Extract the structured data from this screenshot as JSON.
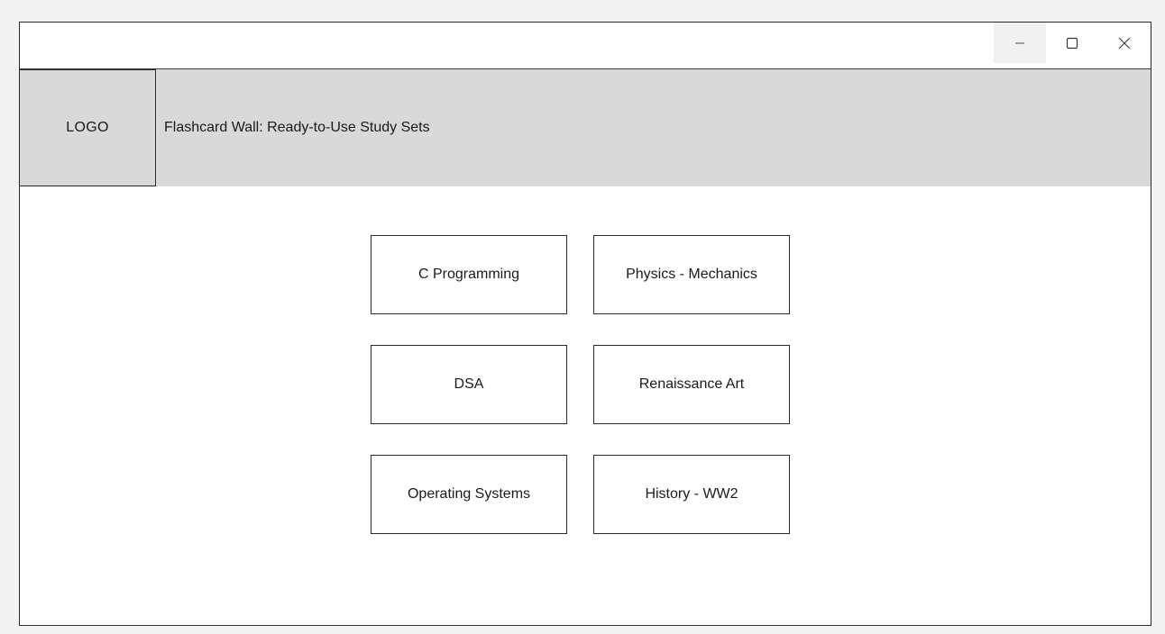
{
  "window": {
    "controls": {
      "minimize_icon": "minimize-icon",
      "maximize_icon": "maximize-icon",
      "close_icon": "close-icon"
    }
  },
  "header": {
    "logo_text": "LOGO",
    "title": "Flashcard Wall: Ready-to-Use Study Sets"
  },
  "cards": [
    {
      "label": "C Programming"
    },
    {
      "label": "Physics - Mechanics"
    },
    {
      "label": "DSA"
    },
    {
      "label": "Renaissance Art"
    },
    {
      "label": "Operating Systems"
    },
    {
      "label": "History - WW2"
    }
  ],
  "colors": {
    "page_background": "#f3f3f3",
    "header_background": "#d9d9d9",
    "border": "#2a2a2a",
    "card_background": "#ffffff"
  }
}
